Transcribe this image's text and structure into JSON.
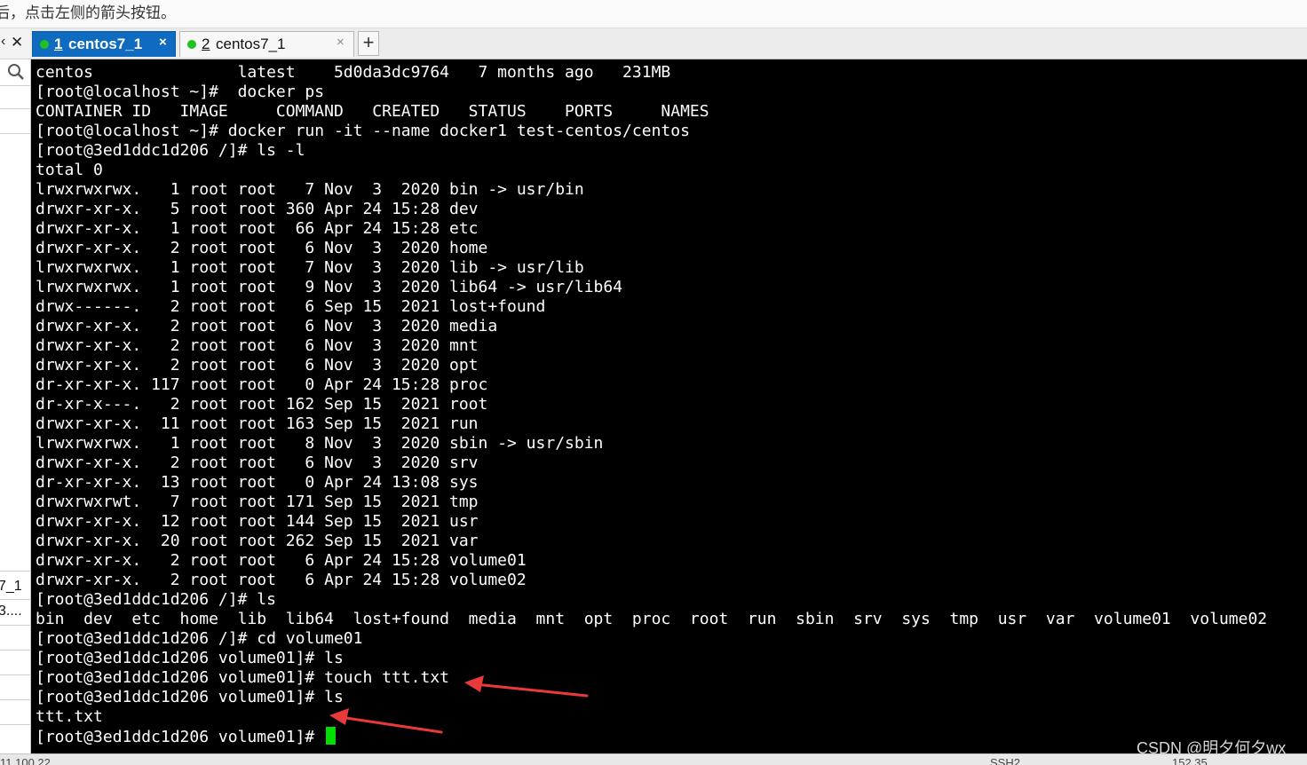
{
  "hint_bar": {
    "text": "后，点击左侧的箭头按钮。"
  },
  "left_panel": {
    "close_glyph": "✕",
    "collapse_glyph": "‹",
    "icons": {
      "search": "search-icon"
    },
    "items": [
      {
        "label": "7_1"
      },
      {
        "label": "3...."
      }
    ]
  },
  "tabs": [
    {
      "number": "1",
      "label": "centos7_1",
      "close": "×",
      "status_color": "#1fc21f",
      "active": true
    },
    {
      "number": "2",
      "label": "centos7_1",
      "close": "×",
      "status_color": "#1fc21f",
      "active": false
    }
  ],
  "add_tab": {
    "label": "+"
  },
  "terminal": {
    "lines": [
      "centos               latest    5d0da3dc9764   7 months ago   231MB",
      "[root@localhost ~]#  docker ps",
      "CONTAINER ID   IMAGE     COMMAND   CREATED   STATUS    PORTS     NAMES",
      "[root@localhost ~]# docker run -it --name docker1 test-centos/centos",
      "[root@3ed1ddc1d206 /]# ls -l",
      "total 0",
      "lrwxrwxrwx.   1 root root   7 Nov  3  2020 bin -> usr/bin",
      "drwxr-xr-x.   5 root root 360 Apr 24 15:28 dev",
      "drwxr-xr-x.   1 root root  66 Apr 24 15:28 etc",
      "drwxr-xr-x.   2 root root   6 Nov  3  2020 home",
      "lrwxrwxrwx.   1 root root   7 Nov  3  2020 lib -> usr/lib",
      "lrwxrwxrwx.   1 root root   9 Nov  3  2020 lib64 -> usr/lib64",
      "drwx------.   2 root root   6 Sep 15  2021 lost+found",
      "drwxr-xr-x.   2 root root   6 Nov  3  2020 media",
      "drwxr-xr-x.   2 root root   6 Nov  3  2020 mnt",
      "drwxr-xr-x.   2 root root   6 Nov  3  2020 opt",
      "dr-xr-xr-x. 117 root root   0 Apr 24 15:28 proc",
      "dr-xr-x---.   2 root root 162 Sep 15  2021 root",
      "drwxr-xr-x.  11 root root 163 Sep 15  2021 run",
      "lrwxrwxrwx.   1 root root   8 Nov  3  2020 sbin -> usr/sbin",
      "drwxr-xr-x.   2 root root   6 Nov  3  2020 srv",
      "dr-xr-xr-x.  13 root root   0 Apr 24 13:08 sys",
      "drwxrwxrwt.   7 root root 171 Sep 15  2021 tmp",
      "drwxr-xr-x.  12 root root 144 Sep 15  2021 usr",
      "drwxr-xr-x.  20 root root 262 Sep 15  2021 var",
      "drwxr-xr-x.   2 root root   6 Apr 24 15:28 volume01",
      "drwxr-xr-x.   2 root root   6 Apr 24 15:28 volume02",
      "[root@3ed1ddc1d206 /]# ls",
      "bin  dev  etc  home  lib  lib64  lost+found  media  mnt  opt  proc  root  run  sbin  srv  sys  tmp  usr  var  volume01  volume02",
      "[root@3ed1ddc1d206 /]# cd volume01",
      "[root@3ed1ddc1d206 volume01]# ls",
      "[root@3ed1ddc1d206 volume01]# touch ttt.txt",
      "[root@3ed1ddc1d206 volume01]# ls",
      "ttt.txt",
      "[root@3ed1ddc1d206 volume01]# "
    ],
    "cursor_color": "#00e000",
    "annotation_color": "#e83a3a"
  },
  "watermark": {
    "text": "CSDN @明夕何夕wx"
  },
  "status_bar": {
    "left": "11.100.22",
    "mid": "SSH2",
    "right": "152.35"
  },
  "colors": {
    "tab_active": "#0e6bbf",
    "terminal_bg": "#000000",
    "terminal_fg": "#ffffff"
  }
}
